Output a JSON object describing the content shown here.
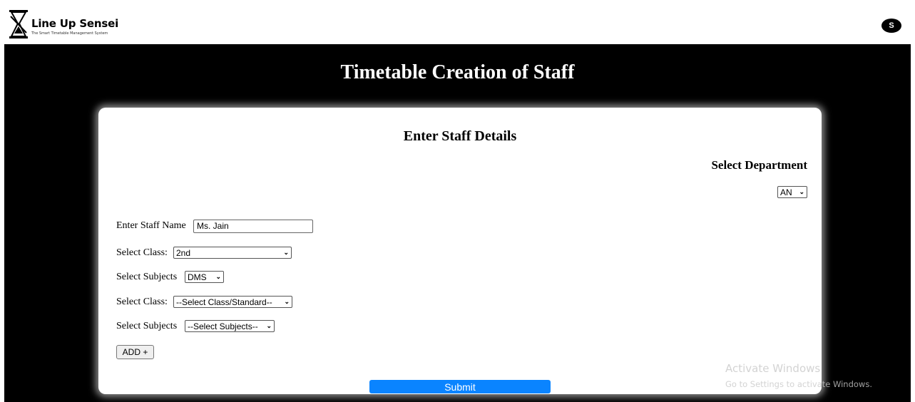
{
  "header": {
    "brand_name": "Line Up Sensei",
    "brand_tagline": "The Smart Timetable Management System",
    "logo_icon": "hourglass-icon",
    "user_initial": "S"
  },
  "page": {
    "title": "Timetable Creation of Staff"
  },
  "form": {
    "title": "Enter Staff Details",
    "department": {
      "label": "Select Department",
      "selected": "AN"
    },
    "staff_name": {
      "label": "Enter Staff Name",
      "value": "Ms. Jain"
    },
    "rows": [
      {
        "class_label": "Select Class:",
        "class_value": "2nd",
        "subjects_label": "Select Subjects",
        "subjects_value": "DMS"
      },
      {
        "class_label": "Select Class:",
        "class_value": "--Select Class/Standard--",
        "subjects_label": "Select Subjects",
        "subjects_value": "--Select Subjects--"
      }
    ],
    "add_button": "ADD +",
    "submit_button": "Submit"
  },
  "watermark": {
    "line1": "Activate Windows",
    "line2": "Go to Settings to activate Windows."
  },
  "colors": {
    "background": "#000000",
    "accent": "#0a84ff"
  }
}
